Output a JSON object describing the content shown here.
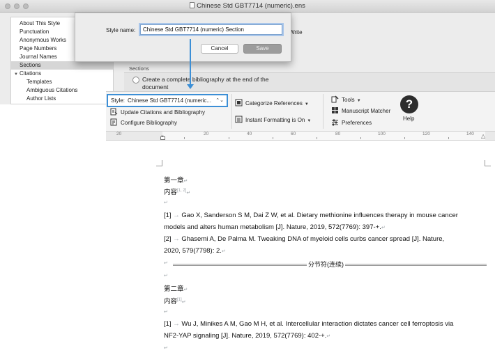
{
  "window": {
    "title": "Chinese Std GBT7714 (numeric).ens"
  },
  "sidebar": {
    "items": [
      {
        "label": "About This Style"
      },
      {
        "label": "Punctuation"
      },
      {
        "label": "Anonymous Works"
      },
      {
        "label": "Page Numbers"
      },
      {
        "label": "Journal Names"
      },
      {
        "label": "Sections",
        "selected": true
      },
      {
        "label": "Citations",
        "expanded": true
      },
      {
        "label": "Templates"
      },
      {
        "label": "Ambiguous Citations"
      },
      {
        "label": "Author Lists"
      }
    ]
  },
  "dialog": {
    "style_name_label": "Style name:",
    "style_name_value": "Chinese Std GBT7714 (numeric) Section",
    "cancel_label": "Cancel",
    "save_label": "Save"
  },
  "main": {
    "write_fragment": "Write",
    "sections_label": "Sections",
    "radio_label": "Create a complete bibliography at the end of the document"
  },
  "ribbon": {
    "style_label": "Style:",
    "style_value": "Chinese Std GBT7714 (numeric...",
    "update_citations": "Update Citations and Bibliography",
    "configure_bibliography": "Configure Bibliography",
    "categorize_references": "Categorize References",
    "instant_formatting": "Instant Formatting is On",
    "tools": "Tools",
    "manuscript_matcher": "Manuscript Matcher",
    "preferences": "Preferences",
    "help": "Help"
  },
  "ruler": {
    "numbers": [
      "20",
      "20",
      "40",
      "60",
      "80",
      "100",
      "120",
      "140"
    ]
  },
  "document": {
    "chapter1_heading": "第一章",
    "chapter1_content": "内容",
    "chapter1_cite": "[1, 2]",
    "ref1_num": "[1]",
    "ref1_line1": "Gao X, Sanderson S M, Dai Z W, et al. Dietary methionine influences therapy in mouse cancer",
    "ref1_line2": "models and alters human metabolism [J]. Nature, 2019, 572(7769): 397-+.",
    "ref2_num": "[2]",
    "ref2_line1": "Ghasemi A, De Palma M. Tweaking DNA of myeloid cells curbs cancer spread [J]. Nature,",
    "ref2_line2": "2020, 579(7798): 2.",
    "section_break": "分节符(连续)",
    "chapter2_heading": "第二章",
    "chapter2_content": "内容",
    "chapter2_cite": "[1]",
    "ref3_num": "[1]",
    "ref3_line1": "Wu J, Minikes A M, Gao M H, et al. Intercellular interaction dictates cancer cell ferroptosis via",
    "ref3_line2": "NF2-YAP signaling [J]. Nature, 2019, 572(7769): 402-+."
  },
  "colors": {
    "highlight": "#3c8fd6",
    "window_bg": "#ececec",
    "ribbon_bg": "#f3f3f3"
  }
}
